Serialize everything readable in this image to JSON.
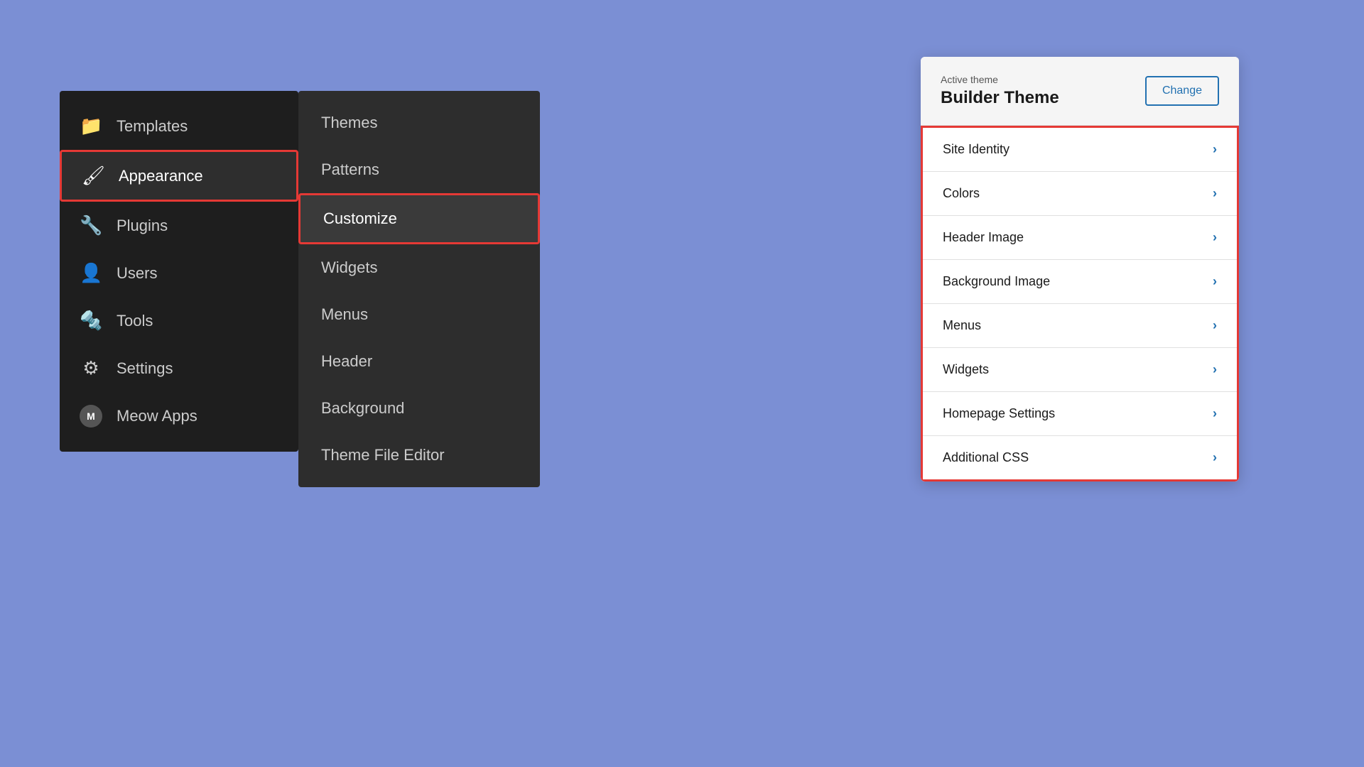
{
  "page": {
    "bg_color": "#7b8fd4"
  },
  "sidebar": {
    "items": [
      {
        "id": "templates",
        "label": "Templates",
        "icon": "📁"
      },
      {
        "id": "appearance",
        "label": "Appearance",
        "icon": "🖌",
        "active": true
      },
      {
        "id": "plugins",
        "label": "Plugins",
        "icon": "🔧"
      },
      {
        "id": "users",
        "label": "Users",
        "icon": "👤"
      },
      {
        "id": "tools",
        "label": "Tools",
        "icon": "🔩"
      },
      {
        "id": "settings",
        "label": "Settings",
        "icon": "⚙"
      },
      {
        "id": "meow-apps",
        "label": "Meow Apps",
        "icon": "M"
      }
    ]
  },
  "submenu": {
    "items": [
      {
        "id": "themes",
        "label": "Themes"
      },
      {
        "id": "patterns",
        "label": "Patterns"
      },
      {
        "id": "customize",
        "label": "Customize",
        "active": true
      },
      {
        "id": "widgets",
        "label": "Widgets"
      },
      {
        "id": "menus",
        "label": "Menus"
      },
      {
        "id": "header",
        "label": "Header"
      },
      {
        "id": "background",
        "label": "Background"
      },
      {
        "id": "theme-file-editor",
        "label": "Theme File Editor"
      }
    ]
  },
  "right_panel": {
    "active_theme": {
      "label": "Active theme",
      "theme_name": "Builder Theme",
      "change_button": "Change"
    },
    "customize_items": [
      {
        "id": "site-identity",
        "label": "Site Identity"
      },
      {
        "id": "colors",
        "label": "Colors"
      },
      {
        "id": "header-image",
        "label": "Header Image"
      },
      {
        "id": "background-image",
        "label": "Background Image"
      },
      {
        "id": "menus",
        "label": "Menus"
      },
      {
        "id": "widgets",
        "label": "Widgets"
      },
      {
        "id": "homepage-settings",
        "label": "Homepage Settings"
      },
      {
        "id": "additional-css",
        "label": "Additional CSS"
      }
    ]
  }
}
